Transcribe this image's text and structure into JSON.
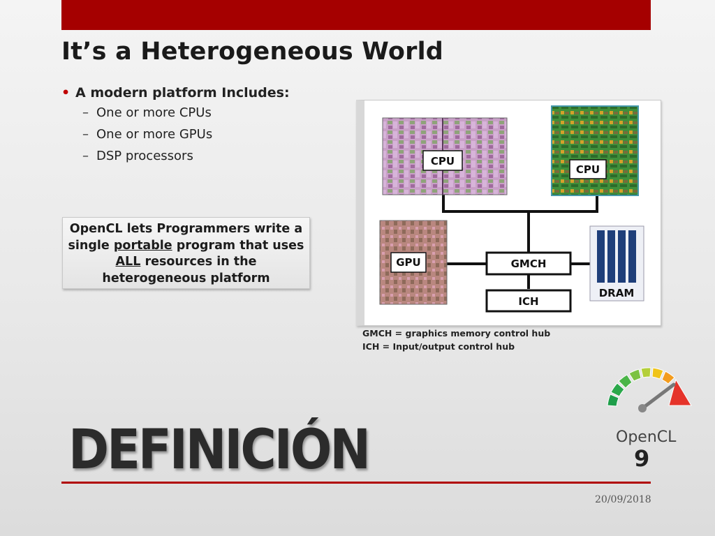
{
  "slide": {
    "title": "It’s a Heterogeneous World",
    "bullet_main": "A modern platform Includes:",
    "bullet_subs": [
      "One or more CPUs",
      "One or more GPUs",
      "DSP processors"
    ],
    "callout": {
      "line1": "OpenCL lets Programmers write a",
      "line2_pre": "single ",
      "line2_u": "portable",
      "line2_post": " program that uses",
      "line3_u": "ALL",
      "line3_post": " resources in the",
      "line4": "heterogeneous platform"
    },
    "diagram": {
      "cpu_left": "CPU",
      "cpu_right": "CPU",
      "gpu": "GPU",
      "gmch": "GMCH",
      "ich": "ICH",
      "dram": "DRAM"
    },
    "legend": [
      "GMCH = graphics memory control hub",
      "ICH = Input/output control hub"
    ],
    "heading": "DEFINICIÓN",
    "brand": "OpenCL",
    "page_number": "9",
    "date": "20/09/2018"
  },
  "colors": {
    "accent": "#a50000",
    "rule": "#b00000"
  }
}
